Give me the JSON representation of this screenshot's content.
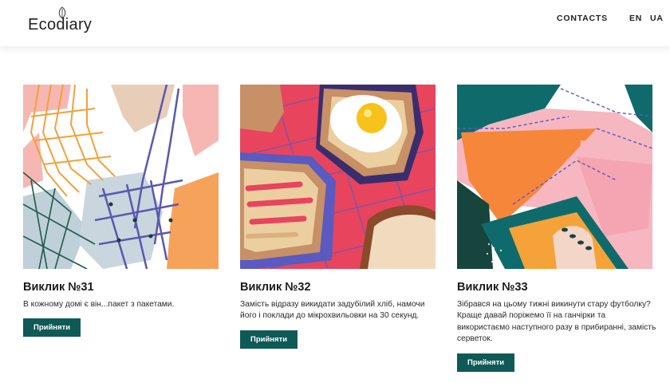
{
  "header": {
    "logo_text": "Ecodiary",
    "nav": {
      "contacts": "CONTACTS",
      "lang_en": "EN",
      "lang_ua": "UA"
    }
  },
  "cards": [
    {
      "title": "Виклик №31",
      "description": "В кожному домі є він...пакет з пакетами.",
      "button_label": "Прийняти",
      "image_alt": "string shopping bag illustration"
    },
    {
      "title": "Виклик №32",
      "description": "Замість відразу викидати задубілий хліб, намочи його і поклади до мікрохвильовки на 30 секунд.",
      "button_label": "Прийняти",
      "image_alt": "toast and fried egg illustration"
    },
    {
      "title": "Виклик №33",
      "description": "Зібрався на цьому тижні викинути стару футболку? Краще давай поріжемо її на ганчірки та використаємо наступного разу в прибиранні, замість серветок.",
      "button_label": "Прийняти",
      "image_alt": "t-shirt and cloth illustration"
    }
  ],
  "colors": {
    "button_bg": "#0f5a56",
    "button_text": "#ffffff",
    "text": "#1a1a1a"
  }
}
